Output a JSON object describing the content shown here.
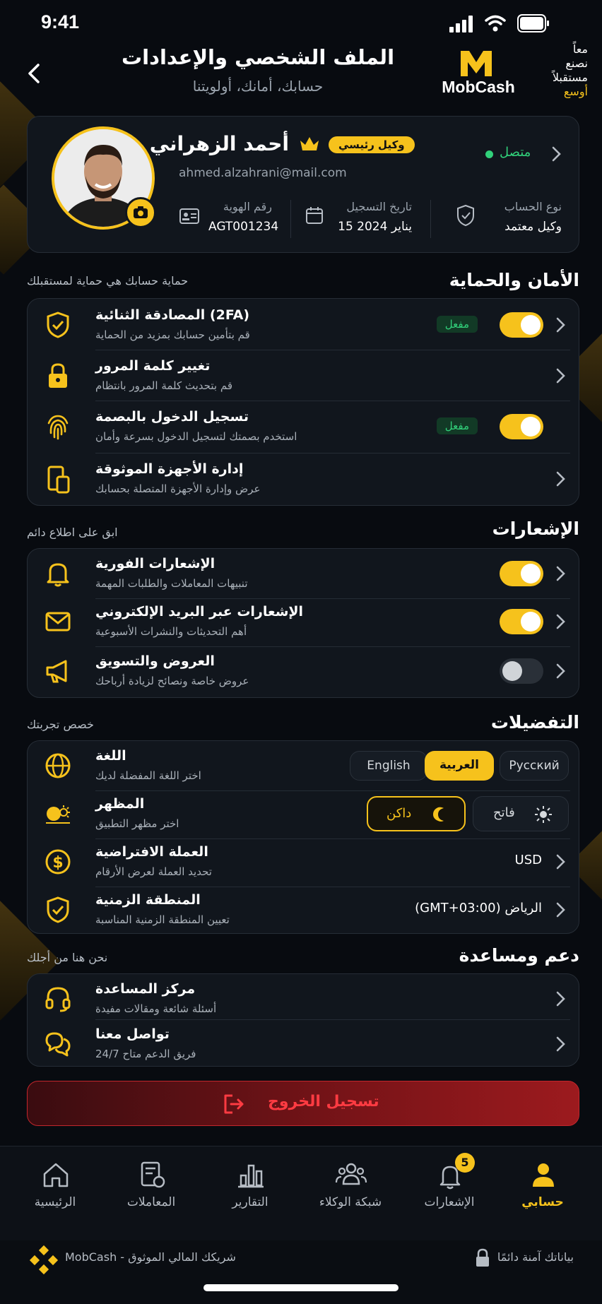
{
  "status_bar": {
    "time": "9:41"
  },
  "header": {
    "title": "الملف الشخصي والإعدادات",
    "subtitle": "حسابك، أمانك، أولويتنا",
    "brand": "MobCash",
    "slogan": [
      "معاً",
      "نصنع",
      "مستقبلاً"
    ],
    "slogan_accent": "أوسع"
  },
  "profile": {
    "name": "أحمد الزهراني",
    "role_badge": "وكيل رئيسي",
    "email": "ahmed.alzahrani@mail.com",
    "status": "متصل",
    "status_color": "#31d07a",
    "id_label": "رقم الهوية",
    "id_value": "AGT001234",
    "reg_label": "تاريخ التسجيل",
    "reg_value": "15 يناير 2024",
    "type_label": "نوع الحساب",
    "type_value": "وكيل معتمد"
  },
  "security": {
    "title": "الأمان والحماية",
    "subtitle": "حماية حسابك هي حماية لمستقبلك",
    "items": [
      {
        "title": "المصادقة الثنائية (2FA)",
        "desc": "قم بتأمين حسابك بمزيد من الحماية",
        "badge": "مفعل",
        "toggle": true,
        "icon": "shield-check-icon"
      },
      {
        "title": "تغيير كلمة المرور",
        "desc": "قم بتحديث كلمة المرور بانتظام",
        "icon": "lock-icon"
      },
      {
        "title": "تسجيل الدخول بالبصمة",
        "desc": "استخدم بصمتك لتسجيل الدخول بسرعة وأمان",
        "badge": "مفعل",
        "toggle": true,
        "icon": "fingerprint-icon"
      },
      {
        "title": "إدارة الأجهزة الموثوقة",
        "desc": "عرض وإدارة الأجهزة المتصلة بحسابك",
        "icon": "devices-icon"
      }
    ]
  },
  "notifications": {
    "title": "الإشعارات",
    "subtitle": "ابق على اطلاع دائم",
    "items": [
      {
        "title": "الإشعارات الفورية",
        "desc": "تنبيهات المعاملات والطلبات المهمة",
        "toggle": true,
        "icon": "bell-icon"
      },
      {
        "title": "الإشعارات عبر البريد الإلكتروني",
        "desc": "أهم التحديثات والنشرات الأسبوعية",
        "toggle": true,
        "icon": "mail-icon"
      },
      {
        "title": "العروض والتسويق",
        "desc": "عروض خاصة ونصائح لزيادة أرباحك",
        "toggle": false,
        "icon": "megaphone-icon"
      }
    ]
  },
  "preferences": {
    "title": "التفضيلات",
    "subtitle": "خصص تجربتك",
    "language": {
      "title": "اللغة",
      "desc": "اختر اللغة المفضلة لديك",
      "options": [
        "English",
        "العربية",
        "Русский"
      ],
      "selected": "العربية"
    },
    "appearance": {
      "title": "المظهر",
      "desc": "اختر مظهر التطبيق",
      "dark": "داكن",
      "light": "فاتح",
      "selected": "داكن"
    },
    "currency": {
      "title": "العملة الافتراضية",
      "desc": "تحديد العملة لعرض الأرقام",
      "value": "USD"
    },
    "timezone": {
      "title": "المنطقة الزمنية",
      "desc": "تعيين المنطقة الزمنية المناسبة",
      "value": "الرياض (GMT+03:00)"
    }
  },
  "support": {
    "title": "دعم ومساعدة",
    "subtitle": "نحن هنا من أجلك",
    "items": [
      {
        "title": "مركز المساعدة",
        "desc": "أسئلة شائعة ومقالات مفيدة",
        "icon": "headset-icon"
      },
      {
        "title": "تواصل معنا",
        "desc": "فريق الدعم متاح 24/7",
        "icon": "chat-icon"
      }
    ]
  },
  "logout": {
    "label": "تسجيل الخروج"
  },
  "bottom_nav": {
    "items": [
      "الرئيسية",
      "المعاملات",
      "التقارير",
      "شبكة الوكلاء",
      "الإشعارات",
      "حسابي"
    ],
    "active": "حسابي",
    "notif_count": "5"
  },
  "footer": {
    "left": "MobCash - شريكك المالي الموثوق",
    "right": "بياناتك آمنة دائمًا"
  },
  "colors": {
    "accent": "#f6c21c",
    "bg": "#080b10",
    "card": "#11161d",
    "danger": "#e0303a"
  }
}
